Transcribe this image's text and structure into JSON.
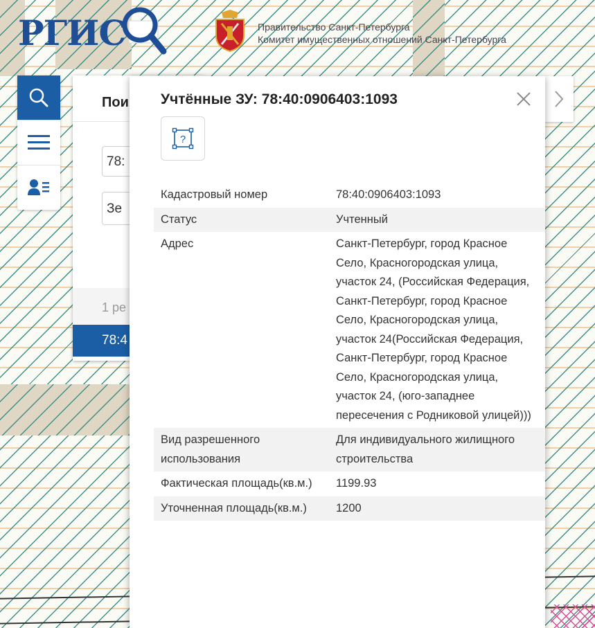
{
  "header": {
    "logo_text": "РГИС",
    "gov_line1": "Правительство Санкт-Петербурга",
    "gov_line2": "Комитет имущественных отношений Санкт-Петербурга"
  },
  "toolbar": {
    "icons": [
      "search-icon",
      "menu-icon",
      "user-list-icon"
    ]
  },
  "search_panel": {
    "title": "Пои",
    "input_value": "78:",
    "select_value": "Зе",
    "result_count": "1 ре",
    "result_item": "78:4"
  },
  "popup": {
    "title": "Учтённые ЗУ: 78:40:0906403:1093",
    "close_icon": "close-icon",
    "help_icon": "help-icon",
    "rows": [
      {
        "label": "Кадастровый номер",
        "value": "78:40:0906403:1093"
      },
      {
        "label": "Статус",
        "value": "Учтенный"
      },
      {
        "label": "Адрес",
        "value": "Санкт-Петербург, город Красное Село, Красногородская улица, участок 24, (Российская Федерация, Санкт-Петербург, город Красное Село, Красногородская улица, участок 24(Российская Федерация, Санкт-Петербург, город Красное Село, Красногородская улица, участок 24, (юго-западнее пересечения с Родниковой улицей)))"
      },
      {
        "label": "Вид разрешенного использования",
        "value": "Для индивидуального жилищного строительства"
      },
      {
        "label": "Фактическая площадь(кв.м.)",
        "value": "1199.93"
      },
      {
        "label": "Уточненная площадь(кв.м.)",
        "value": "1200"
      }
    ]
  },
  "colors": {
    "accent": "#1b5ea6",
    "logo": "#1e4f96",
    "map_hatch": "#3c8f88",
    "map_parcel": "#dfd6c3",
    "map_stripe": "#f2cfa6"
  }
}
